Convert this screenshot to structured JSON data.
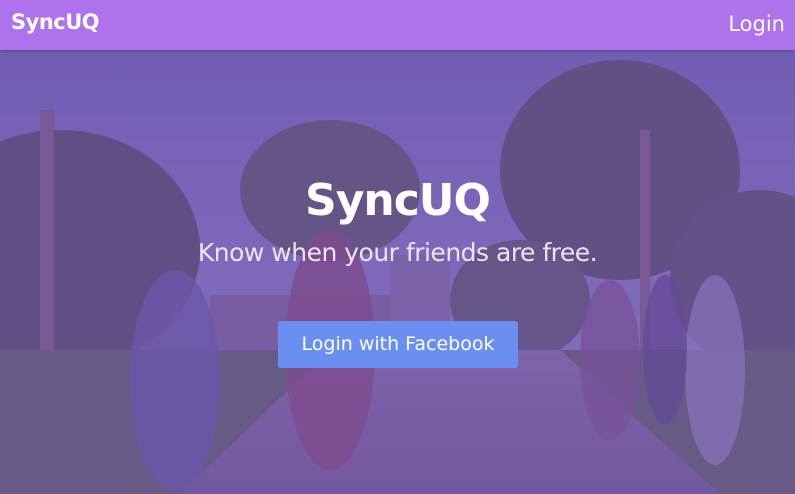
{
  "navbar": {
    "brand": "SyncUQ",
    "login_label": "Login"
  },
  "hero": {
    "title": "SyncUQ",
    "subtitle": "Know when your friends are free.",
    "cta_label": "Login with Facebook",
    "background_description": "campus-photo",
    "overlay_color": "#7648b2"
  },
  "colors": {
    "navbar": "#ad72ec",
    "button": "#6b8ff0",
    "text": "#ffffff"
  }
}
